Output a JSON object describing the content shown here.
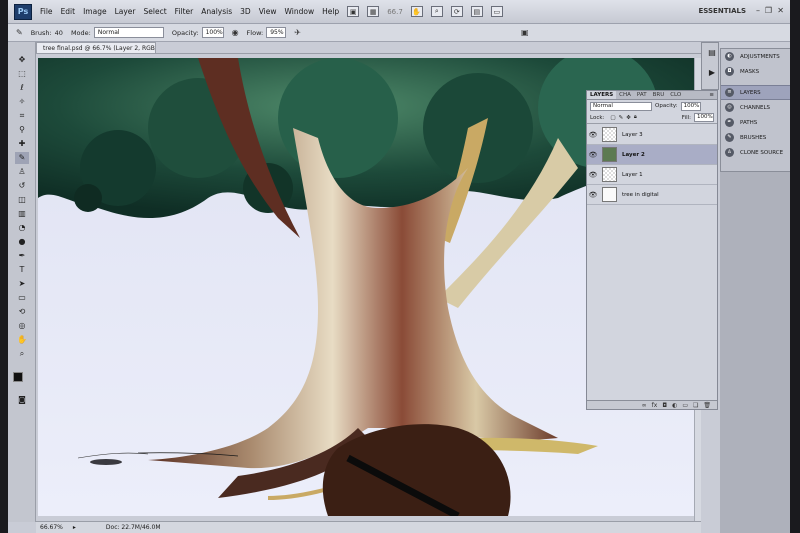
{
  "app": {
    "logo_text": "Ps",
    "menu": [
      "File",
      "Edit",
      "Image",
      "Layer",
      "Select",
      "Filter",
      "Analysis",
      "3D",
      "View",
      "Window",
      "Help"
    ],
    "zoom_readout": "66.7",
    "workspace": "ESSENTIALS"
  },
  "options_bar": {
    "brush_label": "Brush:",
    "brush_size": "40",
    "mode_label": "Mode:",
    "mode_value": "Normal",
    "opacity_label": "Opacity:",
    "opacity_value": "100%",
    "flow_label": "Flow:",
    "flow_value": "95%"
  },
  "document": {
    "tab_title": "tree final.psd @ 66.7% (Layer 2, RGB/8) *",
    "status_zoom": "66.67%",
    "status_doc": "Doc: 22.7M/46.0M"
  },
  "layers_panel": {
    "tabs": [
      "LAYERS",
      "CHA",
      "PAT",
      "BRU",
      "CLO"
    ],
    "blend_mode": "Normal",
    "opacity_label": "Opacity:",
    "opacity_value": "100%",
    "lock_label": "Lock:",
    "fill_label": "Fill:",
    "fill_value": "100%",
    "layers": [
      {
        "name": "Layer 3",
        "selected": false,
        "thumb": "transparent"
      },
      {
        "name": "Layer 2",
        "selected": true,
        "thumb": "art"
      },
      {
        "name": "Layer 1",
        "selected": false,
        "thumb": "transparent"
      },
      {
        "name": "tree in digital",
        "selected": false,
        "thumb": "plain"
      }
    ],
    "footer_icons": [
      "link-icon",
      "fx-icon",
      "mask-icon",
      "adjustment-icon",
      "folder-icon",
      "new-layer-icon",
      "trash-icon"
    ]
  },
  "dock": {
    "group1": [
      "ADJUSTMENTS",
      "MASKS"
    ],
    "group2": [
      "LAYERS",
      "CHANNELS",
      "PATHS",
      "BRUSHES",
      "CLONE SOURCE"
    ],
    "active": "LAYERS"
  }
}
